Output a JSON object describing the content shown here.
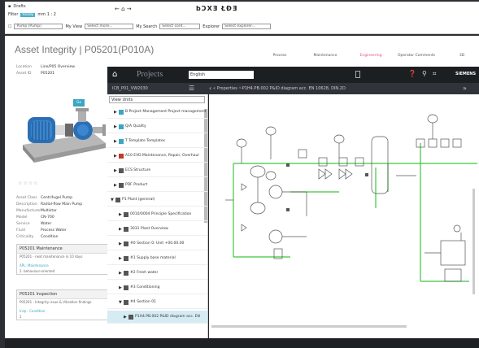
{
  "topbar": {
    "row1": "Drafts",
    "row2_a": "Filter",
    "row2_chip": "Ready",
    "row2_b": "mm 1 : 2",
    "row3_select": "Pump (Pump)",
    "row3_label2": "My View",
    "row3_sel2": "Select more...",
    "row3_label3": "My Search",
    "row3_sel3": "Select cont...",
    "row3_label4": "Explorer",
    "row3_sel4": "Select explorer...",
    "center_nav": "← ⌂ →",
    "logo": "bƆXƎ ŁĐƎ"
  },
  "asset": {
    "title": "Asset Integrity | P05201(P010A)",
    "fields_top": [
      {
        "k": "Location",
        "v": "Line/P05 Overview"
      },
      {
        "k": "Asset ID",
        "v": "P05201"
      }
    ],
    "open_button": "Go",
    "rating": "☆☆☆☆",
    "fields": [
      {
        "k": "Asset Class",
        "v": "Centrifugal Pump"
      },
      {
        "k": "Description",
        "v": "Radial-flow Main Pump"
      },
      {
        "k": "Manufacturer",
        "v": "Multistar"
      },
      {
        "k": "Model",
        "v": "CN-700"
      },
      {
        "k": "Service",
        "v": "Water"
      },
      {
        "k": "Fluid",
        "v": "Process Water"
      },
      {
        "k": "Criticality",
        "v": "Condition"
      }
    ],
    "card1": {
      "title": "P05201 Maintenance",
      "line": "P05201 - next maintenance in 10 days",
      "link": "APL: Maintenance",
      "sub": "2. behaviour-oriented"
    },
    "card2": {
      "title": "P05201 Inspection",
      "line": "P05201 - Integrity issue & Vibration findings",
      "link": "Insp.: Condition",
      "sub": "1"
    }
  },
  "top_tabs": [
    "Process",
    "Maintenance",
    "Engineering",
    "Operator Comments",
    "3D"
  ],
  "viewer": {
    "header": "Projects",
    "language": "English",
    "brand": "SIEMENS",
    "path": "ICB_P01_VW2030",
    "props_label": "«  Properties   ~P1H4.PB.002 P&ID diagram acc. EN 10628, DIN.2D",
    "view_select": "View  Units",
    "tree": [
      {
        "label": "B Project Management  Project management",
        "arrow": "▶",
        "color": "#3aa6c0"
      },
      {
        "label": "Q/A Quality",
        "arrow": "▶",
        "color": "#3aa6c0"
      },
      {
        "label": "T Template  Templates",
        "arrow": "▶",
        "color": "#3aa6c0"
      },
      {
        "label": "A10  EVD  Maintenance, Repair, Overhaul",
        "arrow": "▶",
        "color": "#c0392b"
      },
      {
        "label": "ECS  Structure",
        "arrow": "▶",
        "color": "#555"
      },
      {
        "label": "PDF  Product",
        "arrow": "▶",
        "color": "#555"
      },
      {
        "label": "P1  Plant (general)",
        "arrow": "▼",
        "color": "#555"
      },
      {
        "label": "0010/0004  Principle Specification",
        "arrow": "▶",
        "color": "#555"
      },
      {
        "label": "3031  Plant Overview",
        "arrow": "▶",
        "color": "#555"
      },
      {
        "label": "#0  Section 0: Unit +00.00.00",
        "arrow": "▶",
        "color": "#555"
      },
      {
        "label": "#1  Supply base material",
        "arrow": "▶",
        "color": "#555"
      },
      {
        "label": "#2  Fresh water",
        "arrow": "▶",
        "color": "#555"
      },
      {
        "label": "#3  Conditioning",
        "arrow": "▶",
        "color": "#555"
      },
      {
        "label": "#4  Section 01",
        "arrow": "▼",
        "color": "#555"
      },
      {
        "label": "P1H4.PB.002  P&ID diagram acc. EN",
        "arrow": "▶",
        "color": "#555"
      }
    ]
  }
}
